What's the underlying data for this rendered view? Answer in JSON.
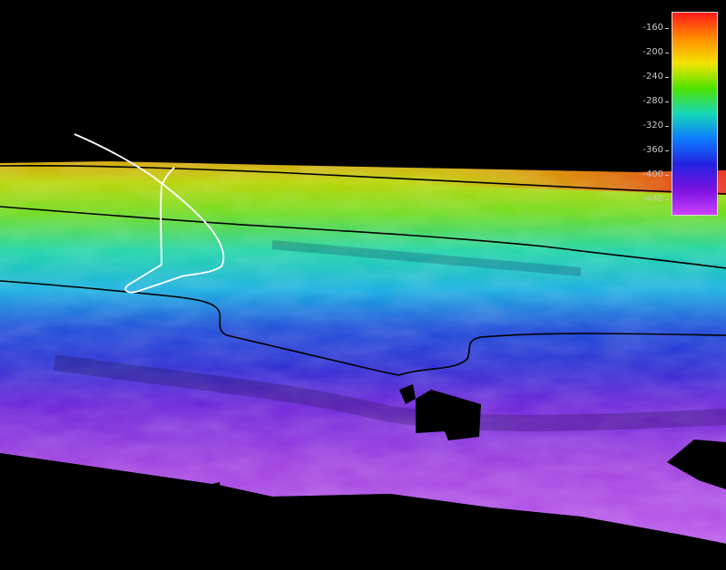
{
  "colorbar": {
    "ticks": [
      "-160",
      "-200",
      "-240",
      "-280",
      "-320",
      "-360",
      "-400",
      "-440"
    ],
    "colors": [
      "#ff1a1a",
      "#ff8a00",
      "#f4e400",
      "#4ee300",
      "#16d7b8",
      "#0d7bff",
      "#2222e0",
      "#7a12e0",
      "#cc40ff"
    ]
  },
  "terrain": {
    "palette": {
      "shallow": "#e23a10",
      "mid_shallow": "#b9d400",
      "mid": "#17c9b0",
      "mid_deep": "#1a4ad8",
      "deep": "#8a22d8",
      "deepest": "#b24fe6"
    },
    "contour_color": "#000000",
    "track_color": "#ffffff"
  }
}
